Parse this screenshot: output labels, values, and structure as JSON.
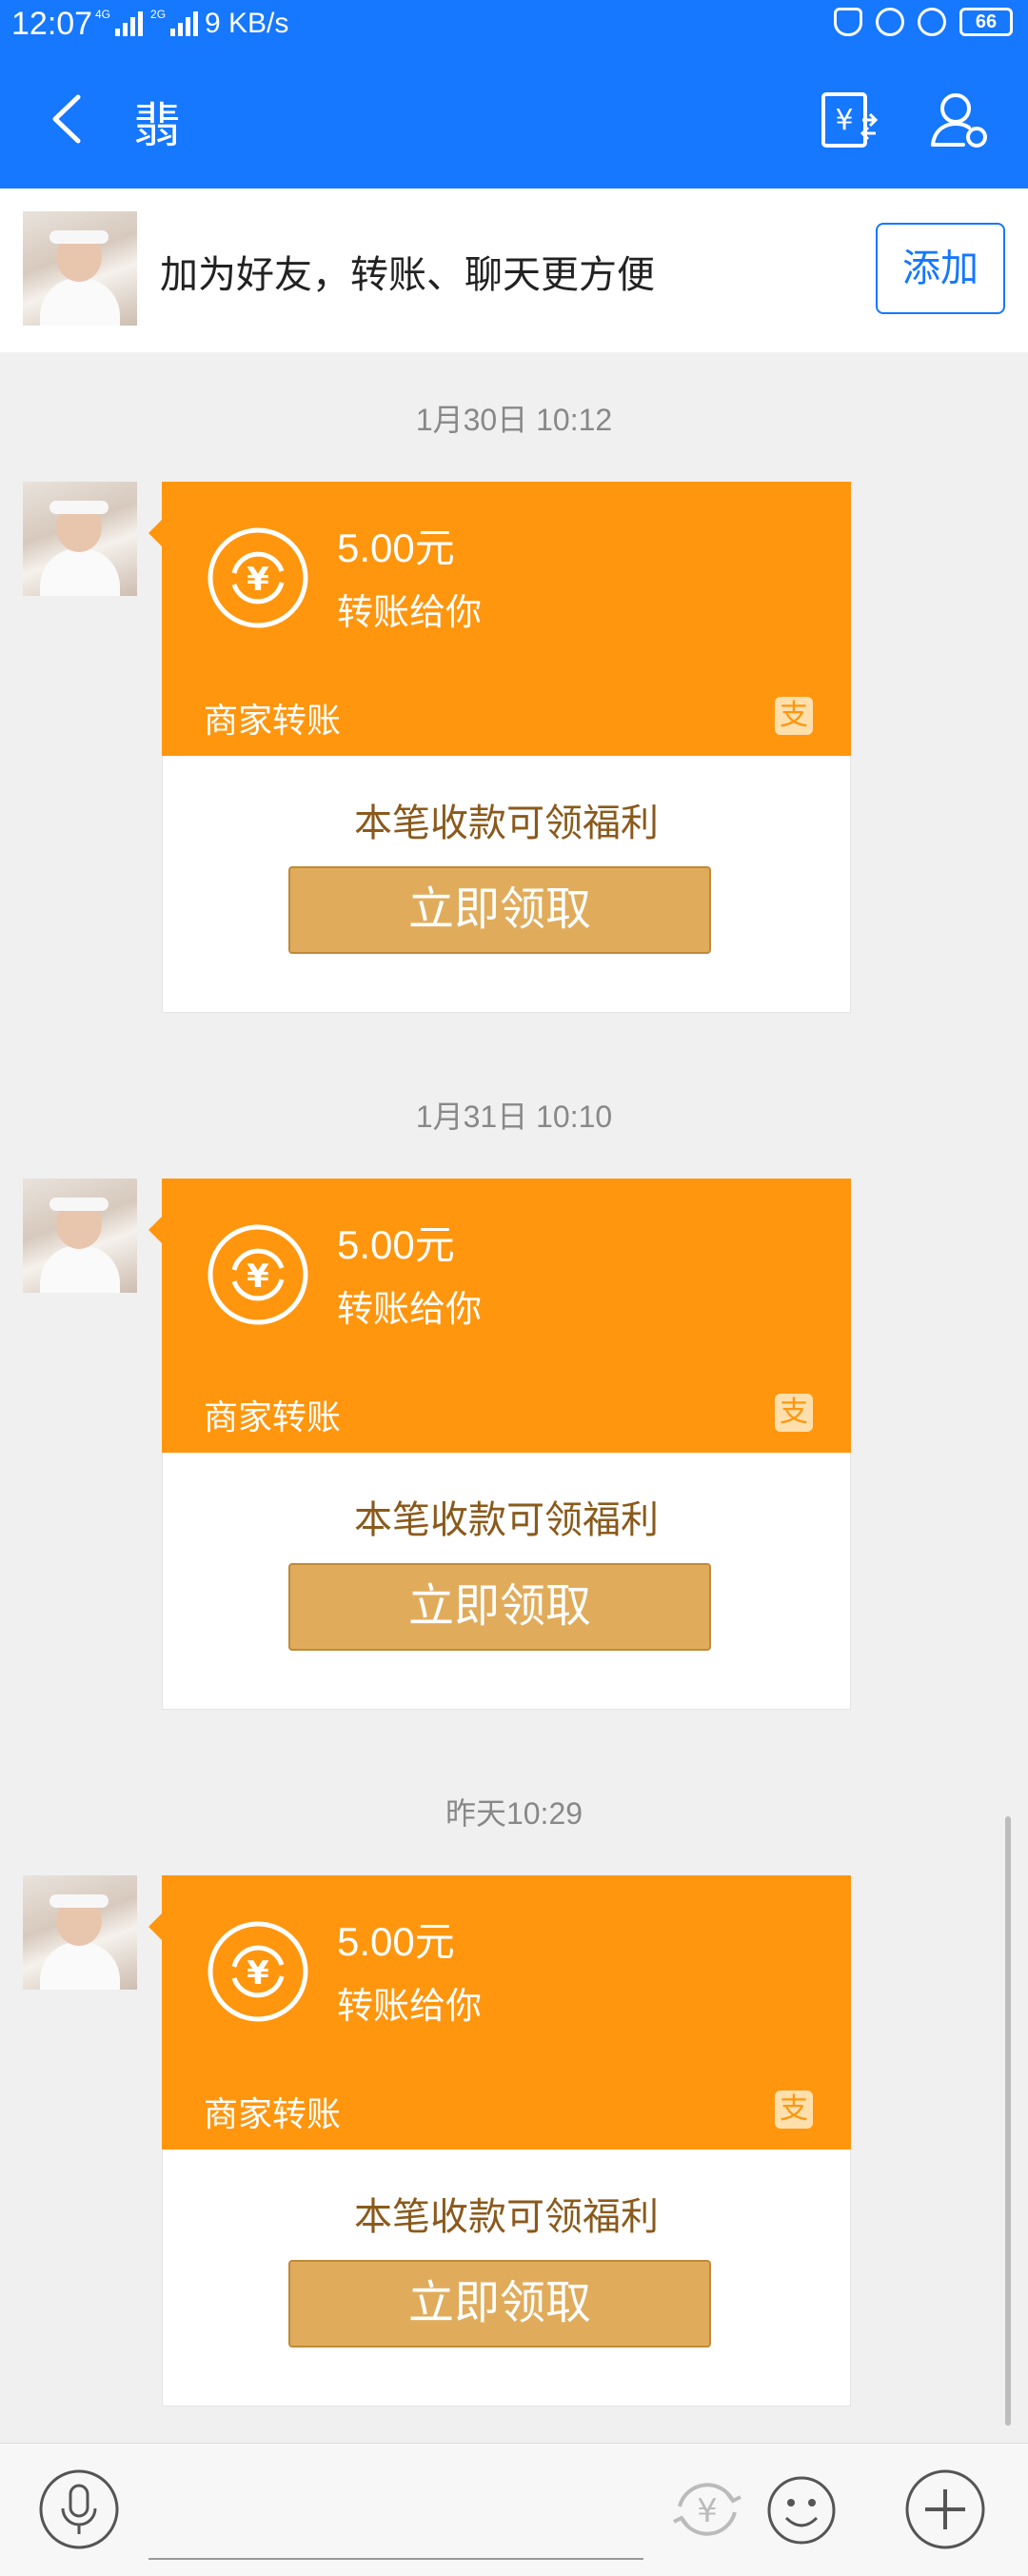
{
  "status": {
    "time": "12:07",
    "net1": "4G",
    "net2": "2G",
    "speed": "9 KB/s",
    "battery": "66"
  },
  "header": {
    "title": "翡",
    "back_icon": "chevron-left-icon",
    "bill_icon": "bill-transfer-icon",
    "profile_icon": "user-settings-icon"
  },
  "banner": {
    "text": "加为好友，转账、聊天更方便",
    "add_label": "添加"
  },
  "messages": [
    {
      "timestamp": "1月30日 10:12",
      "amount": "5.00元",
      "subtitle": "转账给你",
      "merchant": "商家转账",
      "benefit": "本笔收款可领福利",
      "button": "立即领取"
    },
    {
      "timestamp": "1月31日 10:10",
      "amount": "5.00元",
      "subtitle": "转账给你",
      "merchant": "商家转账",
      "benefit": "本笔收款可领福利",
      "button": "立即领取"
    },
    {
      "timestamp": "昨天10:29",
      "amount": "5.00元",
      "subtitle": "转账给你",
      "merchant": "商家转账",
      "benefit": "本笔收款可领福利",
      "button": "立即领取"
    }
  ],
  "bottom_bar": {
    "icons": [
      "microphone-icon",
      "yuan-transfer-icon",
      "emoji-icon",
      "plus-icon"
    ]
  },
  "colors": {
    "brand_blue": "#1677ff",
    "card_orange": "#ff960e",
    "claim_gold": "#e0ac5c"
  }
}
